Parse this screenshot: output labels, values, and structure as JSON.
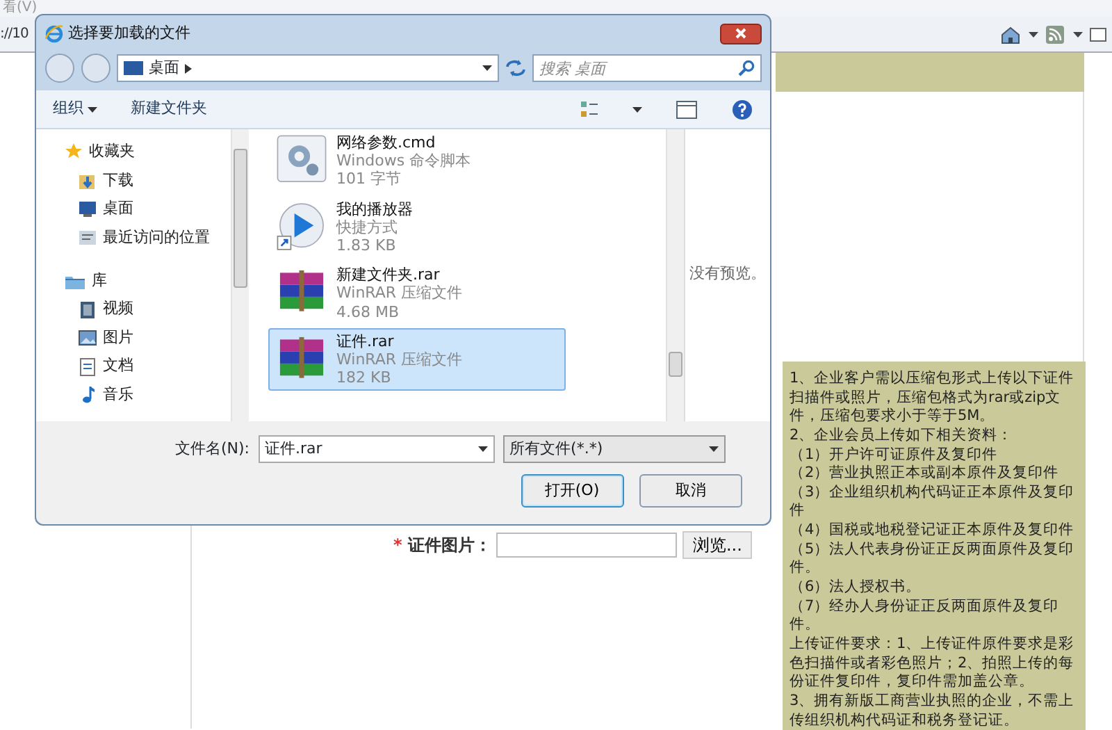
{
  "browser": {
    "menu": [
      "看(V)"
    ],
    "address": "://10"
  },
  "page": {
    "required_mark": "*",
    "upload_label": "证件图片：",
    "browse_button": "浏览...",
    "tips": [
      "1、企业客户需以压缩包形式上传以下证件扫描件或照片，压缩包格式为rar或zip文件，压缩包要求小于等于5M。",
      "2、企业会员上传如下相关资料：",
      "（1）开户许可证原件及复印件",
      "（2）营业执照正本或副本原件及复印件",
      "（3）企业组织机构代码证正本原件及复印件",
      "（4）国税或地税登记证正本原件及复印件",
      "（5）法人代表身份证正反两面原件及复印件。",
      "（6）法人授权书。",
      "（7）经办人身份证正反两面原件及复印件。",
      "上传证件要求：1、上传证件原件要求是彩色扫描件或者彩色照片；2、拍照上传的每份证件复印件，复印件需加盖公章。",
      "3、拥有新版工商营业执照的企业，不需上传组织机构代码证和税务登记证。"
    ]
  },
  "dialog": {
    "title": "选择要加载的文件",
    "breadcrumb": "桌面",
    "search_placeholder": "搜索 桌面",
    "toolbar": {
      "organize": "组织",
      "new_folder": "新建文件夹"
    },
    "nav": [
      {
        "label": "收藏夹",
        "kind": "star",
        "children": [
          {
            "label": "下载",
            "kind": "download"
          },
          {
            "label": "桌面",
            "kind": "desktop"
          },
          {
            "label": "最近访问的位置",
            "kind": "recent"
          }
        ]
      },
      {
        "label": "库",
        "kind": "library",
        "children": [
          {
            "label": "视频",
            "kind": "video"
          },
          {
            "label": "图片",
            "kind": "picture"
          },
          {
            "label": "文档",
            "kind": "document"
          },
          {
            "label": "音乐",
            "kind": "music"
          }
        ]
      }
    ],
    "files": [
      {
        "name": "网络参数.cmd",
        "type": "Windows 命令脚本",
        "size": "101 字节",
        "kind": "script",
        "selected": false
      },
      {
        "name": "我的播放器",
        "type": "快捷方式",
        "size": "1.83 KB",
        "kind": "shortcut",
        "selected": false
      },
      {
        "name": "新建文件夹.rar",
        "type": "WinRAR 压缩文件",
        "size": "4.68 MB",
        "kind": "archive",
        "selected": false
      },
      {
        "name": "证件.rar",
        "type": "WinRAR 压缩文件",
        "size": "182 KB",
        "kind": "archive",
        "selected": true
      }
    ],
    "preview": "没有预览。",
    "filename_label": "文件名(N):",
    "filename": "证件.rar",
    "filter": "所有文件(*.*)",
    "open_button": "打开(O)",
    "cancel_button": "取消"
  }
}
